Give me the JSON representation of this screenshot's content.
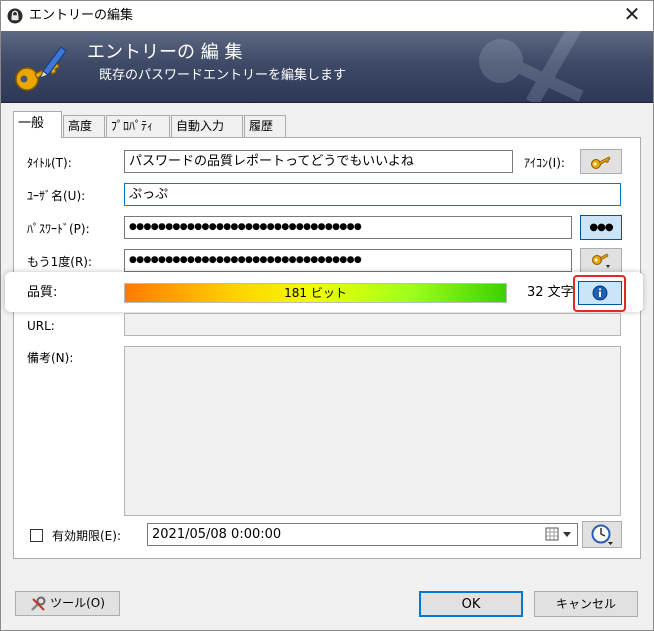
{
  "window": {
    "title": "エントリーの編集",
    "close_glyph": "✕"
  },
  "banner": {
    "title": "エントリーの 編 集",
    "subtitle": "既存のパスワードエントリーを編集します"
  },
  "tabs": [
    {
      "label": "一般",
      "active": true
    },
    {
      "label": "高度",
      "active": false
    },
    {
      "label": "ﾌﾟﾛﾊﾟﾃｨ",
      "active": false
    },
    {
      "label": "自動入力",
      "active": false
    },
    {
      "label": "履歴",
      "active": false
    }
  ],
  "fields": {
    "title": {
      "label": "ﾀｲﾄﾙ(T):",
      "value": "パスワードの品質レポートってどうでもいいよね"
    },
    "icon_label": "ｱｲｺﾝ(I):",
    "username": {
      "label": "ﾕｰｻﾞ名(U):",
      "value": "ぷっぷ"
    },
    "password": {
      "label": "ﾊﾟｽﾜｰﾄﾞ(P):",
      "value": "●●●●●●●●●●●●●●●●●●●●●●●●●●●●●●●●"
    },
    "repeat": {
      "label": "もう1度(R):",
      "value": "●●●●●●●●●●●●●●●●●●●●●●●●●●●●●●●●"
    },
    "quality": {
      "label": "品質:",
      "bar_text": "181 ビット",
      "chars_text": "32 文字",
      "level": 1.0
    },
    "url": {
      "label": "URL:",
      "value": ""
    },
    "notes": {
      "label": "備考(N):",
      "value": ""
    },
    "expires": {
      "label": "有効期限(E):",
      "value": "2021/05/08   0:00:00",
      "checked": false
    }
  },
  "buttons": {
    "show_password": "●●●",
    "tools": "ツール(O)",
    "ok": "OK",
    "cancel": "キャンセル"
  },
  "colors": {
    "banner": "#3e4a66",
    "focus_border": "#0078d7",
    "highlight": "#e0282c",
    "info_blue": "#1e5fb4"
  }
}
